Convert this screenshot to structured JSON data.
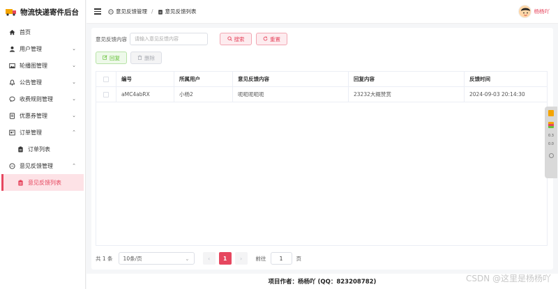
{
  "app": {
    "title": "物流快递寄件后台"
  },
  "sidebar": {
    "items": [
      {
        "label": "首页",
        "icon": "home-icon"
      },
      {
        "label": "用户管理",
        "icon": "user-icon",
        "chevron": "down"
      },
      {
        "label": "轮播图管理",
        "icon": "image-icon",
        "chevron": "down"
      },
      {
        "label": "公告管理",
        "icon": "bell-icon",
        "chevron": "down"
      },
      {
        "label": "收费规则管理",
        "icon": "message-icon",
        "chevron": "down"
      },
      {
        "label": "优惠券管理",
        "icon": "ticket-icon",
        "chevron": "down"
      },
      {
        "label": "订单管理",
        "icon": "order-icon",
        "chevron": "up"
      },
      {
        "label": "订单列表",
        "icon": "list-icon",
        "sub": true
      },
      {
        "label": "意见反馈管理",
        "icon": "feedback-icon",
        "chevron": "up"
      },
      {
        "label": "意见反馈列表",
        "icon": "list-icon",
        "sub": true,
        "active": true
      }
    ]
  },
  "header": {
    "breadcrumb": [
      "意见反馈管理",
      "意见反馈列表"
    ],
    "username": "杨杨吖"
  },
  "search": {
    "label": "意见反馈内容",
    "placeholder": "请输入意见反馈内容",
    "search_button": "搜索",
    "reset_button": "重置"
  },
  "actions": {
    "reply_button": "回复",
    "delete_button": "删除"
  },
  "table": {
    "columns": [
      "编号",
      "所属用户",
      "意见反馈内容",
      "回复内容",
      "反馈时间"
    ],
    "rows": [
      [
        "aMC4abRX",
        "小杨2",
        "呃呃呃呃呃",
        "23232大概赞赏",
        "2024-09-03 20:14:30"
      ]
    ]
  },
  "pagination": {
    "total": "共 1 条",
    "page_size": "10条/页",
    "current_page": "1",
    "goto_label": "前往",
    "goto_value": "1",
    "page_suffix": "页"
  },
  "footer": {
    "author": "项目作者：杨杨吖 (QQ：823208782)"
  },
  "watermark": "CSDN @这里是杨杨吖",
  "float_widget": {
    "lines": [
      "0.3",
      "0.0"
    ]
  },
  "colors": {
    "accent": "#e6475f",
    "success": "#67c23a",
    "active_bg": "#fde2e6"
  }
}
